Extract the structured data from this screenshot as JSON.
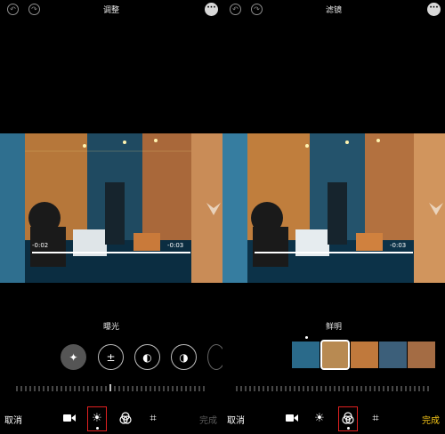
{
  "left": {
    "title": "调整",
    "section_label": "曝光",
    "time_left": "-0:02",
    "time_right": "-0:03",
    "cancel": "取消",
    "done": "完成",
    "tools": [
      "magic-wand-icon",
      "exposure-icon",
      "contrast-icon",
      "brilliance-icon"
    ],
    "bottom_icons": [
      "video-icon",
      "adjust-icon",
      "filters-icon",
      "crop-icon"
    ]
  },
  "right": {
    "title": "滤镜",
    "section_label": "鲜明",
    "time_right": "-0:03",
    "cancel": "取消",
    "done": "完成",
    "bottom_icons": [
      "video-icon",
      "adjust-icon",
      "filters-icon",
      "crop-icon"
    ]
  },
  "colors": {
    "done_active": "#f5c518",
    "done_inactive": "#5a5a5a",
    "highlight": "#e02020"
  }
}
